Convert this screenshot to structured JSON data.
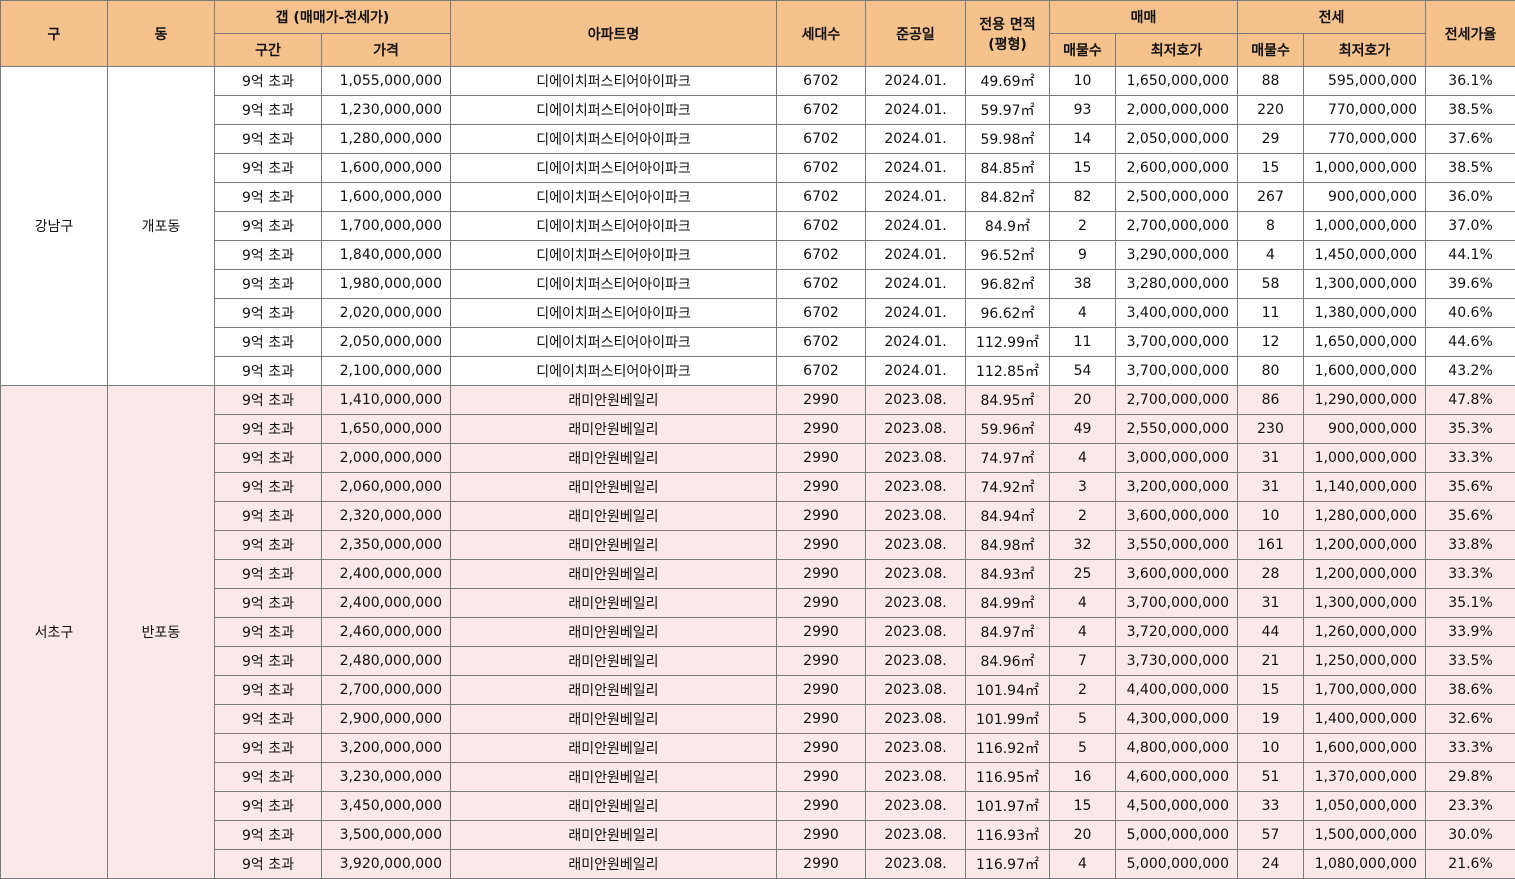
{
  "headers": {
    "gu": "구",
    "dong": "동",
    "gap": "갭 (매매가-전세가)",
    "gap_range": "구간",
    "gap_price": "가격",
    "apt_name": "아파트명",
    "households": "세대수",
    "completion": "준공일",
    "area_l1": "전용 면적",
    "area_l2": "(평형)",
    "sale": "매매",
    "sale_count": "매물수",
    "sale_min": "최저호가",
    "jeonse": "전세",
    "jeonse_count": "매물수",
    "jeonse_min": "최저호가",
    "ratio": "전세가율"
  },
  "groups": [
    {
      "gu": "강남구",
      "dong": "개포동",
      "rows": [
        [
          "9억 초과",
          "1,055,000,000",
          "디에이치퍼스티어아이파크",
          "6702",
          "2024.01.",
          "49.69㎡",
          "10",
          "1,650,000,000",
          "88",
          "595,000,000",
          "36.1%"
        ],
        [
          "9억 초과",
          "1,230,000,000",
          "디에이치퍼스티어아이파크",
          "6702",
          "2024.01.",
          "59.97㎡",
          "93",
          "2,000,000,000",
          "220",
          "770,000,000",
          "38.5%"
        ],
        [
          "9억 초과",
          "1,280,000,000",
          "디에이치퍼스티어아이파크",
          "6702",
          "2024.01.",
          "59.98㎡",
          "14",
          "2,050,000,000",
          "29",
          "770,000,000",
          "37.6%"
        ],
        [
          "9억 초과",
          "1,600,000,000",
          "디에이치퍼스티어아이파크",
          "6702",
          "2024.01.",
          "84.85㎡",
          "15",
          "2,600,000,000",
          "15",
          "1,000,000,000",
          "38.5%"
        ],
        [
          "9억 초과",
          "1,600,000,000",
          "디에이치퍼스티어아이파크",
          "6702",
          "2024.01.",
          "84.82㎡",
          "82",
          "2,500,000,000",
          "267",
          "900,000,000",
          "36.0%"
        ],
        [
          "9억 초과",
          "1,700,000,000",
          "디에이치퍼스티어아이파크",
          "6702",
          "2024.01.",
          "84.9㎡",
          "2",
          "2,700,000,000",
          "8",
          "1,000,000,000",
          "37.0%"
        ],
        [
          "9억 초과",
          "1,840,000,000",
          "디에이치퍼스티어아이파크",
          "6702",
          "2024.01.",
          "96.52㎡",
          "9",
          "3,290,000,000",
          "4",
          "1,450,000,000",
          "44.1%"
        ],
        [
          "9억 초과",
          "1,980,000,000",
          "디에이치퍼스티어아이파크",
          "6702",
          "2024.01.",
          "96.82㎡",
          "38",
          "3,280,000,000",
          "58",
          "1,300,000,000",
          "39.6%"
        ],
        [
          "9억 초과",
          "2,020,000,000",
          "디에이치퍼스티어아이파크",
          "6702",
          "2024.01.",
          "96.62㎡",
          "4",
          "3,400,000,000",
          "11",
          "1,380,000,000",
          "40.6%"
        ],
        [
          "9억 초과",
          "2,050,000,000",
          "디에이치퍼스티어아이파크",
          "6702",
          "2024.01.",
          "112.99㎡",
          "11",
          "3,700,000,000",
          "12",
          "1,650,000,000",
          "44.6%"
        ],
        [
          "9억 초과",
          "2,100,000,000",
          "디에이치퍼스티어아이파크",
          "6702",
          "2024.01.",
          "112.85㎡",
          "54",
          "3,700,000,000",
          "80",
          "1,600,000,000",
          "43.2%"
        ]
      ]
    },
    {
      "gu": "서초구",
      "dong": "반포동",
      "rows": [
        [
          "9억 초과",
          "1,410,000,000",
          "래미안원베일리",
          "2990",
          "2023.08.",
          "84.95㎡",
          "20",
          "2,700,000,000",
          "86",
          "1,290,000,000",
          "47.8%"
        ],
        [
          "9억 초과",
          "1,650,000,000",
          "래미안원베일리",
          "2990",
          "2023.08.",
          "59.96㎡",
          "49",
          "2,550,000,000",
          "230",
          "900,000,000",
          "35.3%"
        ],
        [
          "9억 초과",
          "2,000,000,000",
          "래미안원베일리",
          "2990",
          "2023.08.",
          "74.97㎡",
          "4",
          "3,000,000,000",
          "31",
          "1,000,000,000",
          "33.3%"
        ],
        [
          "9억 초과",
          "2,060,000,000",
          "래미안원베일리",
          "2990",
          "2023.08.",
          "74.92㎡",
          "3",
          "3,200,000,000",
          "31",
          "1,140,000,000",
          "35.6%"
        ],
        [
          "9억 초과",
          "2,320,000,000",
          "래미안원베일리",
          "2990",
          "2023.08.",
          "84.94㎡",
          "2",
          "3,600,000,000",
          "10",
          "1,280,000,000",
          "35.6%"
        ],
        [
          "9억 초과",
          "2,350,000,000",
          "래미안원베일리",
          "2990",
          "2023.08.",
          "84.98㎡",
          "32",
          "3,550,000,000",
          "161",
          "1,200,000,000",
          "33.8%"
        ],
        [
          "9억 초과",
          "2,400,000,000",
          "래미안원베일리",
          "2990",
          "2023.08.",
          "84.93㎡",
          "25",
          "3,600,000,000",
          "28",
          "1,200,000,000",
          "33.3%"
        ],
        [
          "9억 초과",
          "2,400,000,000",
          "래미안원베일리",
          "2990",
          "2023.08.",
          "84.99㎡",
          "4",
          "3,700,000,000",
          "31",
          "1,300,000,000",
          "35.1%"
        ],
        [
          "9억 초과",
          "2,460,000,000",
          "래미안원베일리",
          "2990",
          "2023.08.",
          "84.97㎡",
          "4",
          "3,720,000,000",
          "44",
          "1,260,000,000",
          "33.9%"
        ],
        [
          "9억 초과",
          "2,480,000,000",
          "래미안원베일리",
          "2990",
          "2023.08.",
          "84.96㎡",
          "7",
          "3,730,000,000",
          "21",
          "1,250,000,000",
          "33.5%"
        ],
        [
          "9억 초과",
          "2,700,000,000",
          "래미안원베일리",
          "2990",
          "2023.08.",
          "101.94㎡",
          "2",
          "4,400,000,000",
          "15",
          "1,700,000,000",
          "38.6%"
        ],
        [
          "9억 초과",
          "2,900,000,000",
          "래미안원베일리",
          "2990",
          "2023.08.",
          "101.99㎡",
          "5",
          "4,300,000,000",
          "19",
          "1,400,000,000",
          "32.6%"
        ],
        [
          "9억 초과",
          "3,200,000,000",
          "래미안원베일리",
          "2990",
          "2023.08.",
          "116.92㎡",
          "5",
          "4,800,000,000",
          "10",
          "1,600,000,000",
          "33.3%"
        ],
        [
          "9억 초과",
          "3,230,000,000",
          "래미안원베일리",
          "2990",
          "2023.08.",
          "116.95㎡",
          "16",
          "4,600,000,000",
          "51",
          "1,370,000,000",
          "29.8%"
        ],
        [
          "9억 초과",
          "3,450,000,000",
          "래미안원베일리",
          "2990",
          "2023.08.",
          "101.97㎡",
          "15",
          "4,500,000,000",
          "33",
          "1,050,000,000",
          "23.3%"
        ],
        [
          "9억 초과",
          "3,500,000,000",
          "래미안원베일리",
          "2990",
          "2023.08.",
          "116.93㎡",
          "20",
          "5,000,000,000",
          "57",
          "1,500,000,000",
          "30.0%"
        ],
        [
          "9억 초과",
          "3,920,000,000",
          "래미안원베일리",
          "2990",
          "2023.08.",
          "116.97㎡",
          "4",
          "5,000,000,000",
          "24",
          "1,080,000,000",
          "21.6%"
        ]
      ]
    }
  ]
}
